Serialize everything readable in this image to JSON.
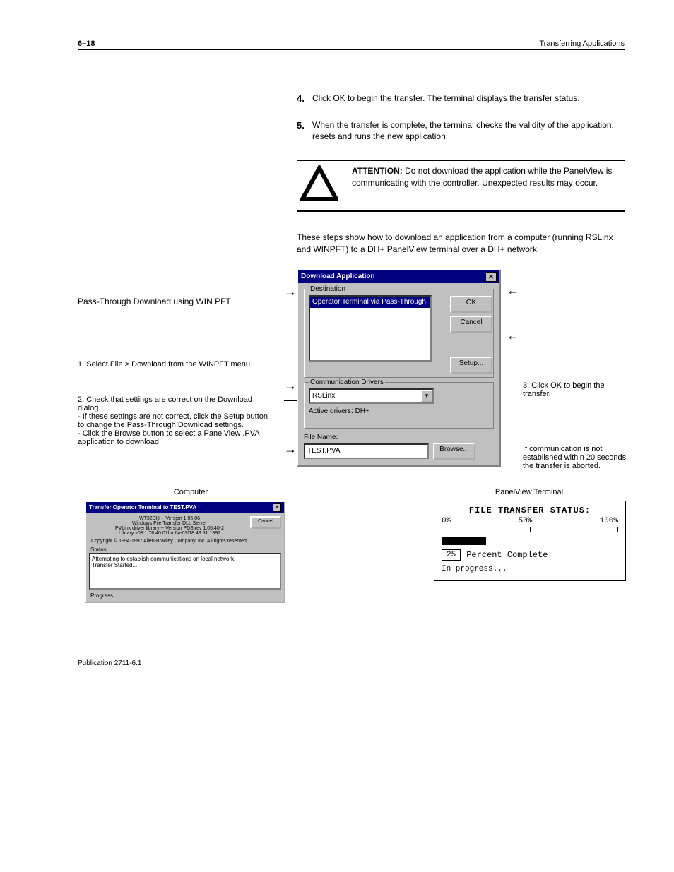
{
  "header": {
    "page_number": "6–18",
    "chapter": "Transferring Applications"
  },
  "steps": [
    {
      "num": "4.",
      "text": "Click OK to begin the transfer. The terminal displays the transfer status."
    },
    {
      "num": "5.",
      "text": "When the transfer is complete, the terminal checks the validity of the application, resets and runs the new application."
    }
  ],
  "attention": {
    "title": "ATTENTION:",
    "text": "Do not download the application while the PanelView is communicating with the controller. Unexpected results may occur."
  },
  "left_heading": "Pass-Through Download using WIN PFT",
  "intro": "These steps show how to download an application from a computer (running RSLinx and WINPFT) to a DH+ PanelView terminal over a DH+ network.",
  "dialog": {
    "title": "Download Application",
    "destination_label": "Destination",
    "destination_item": "Operator Terminal via Pass-Through",
    "ok": "OK",
    "cancel": "Cancel",
    "setup": "Setup...",
    "comm_label": "Communication Drivers",
    "comm_value": "RSLinx",
    "active_label": "Active drivers: DH+",
    "file_label": "File Name:",
    "file_value": "TEST.PVA",
    "browse": "Browse..."
  },
  "callouts": {
    "c1": "1. Select File > Download from the WINPFT menu.",
    "c2": "2. Check that settings are correct on the Download dialog.\n - If these settings are not correct, click the Setup button to change the Pass-Through Download settings.\n - Click the Browse button to select a PanelView .PVA application to download.",
    "c3": "3. Click OK to begin the transfer.",
    "c4": "If communication is not established within 20 seconds, the transfer is aborted."
  },
  "bottom": {
    "left_label": "Computer",
    "right_label": "PanelView Terminal",
    "transfer_title": "Transfer Operator Terminal to TEST.PVA",
    "small_ver": "WT32DH  --  Version 1.05.06",
    "small_l1": "Windows File Transfer DLL Server",
    "small_l2": "PVLink driver library -- Version PDS:rev 1.05.40-2",
    "small_l3": "Library    v03.1.76.40.01hu.64-03/18.49.51.1997",
    "small_copy": "Copyright © 1994-1997 Allen-Bradley Company, Inc.  All rights reserved.",
    "small_status": "Status:",
    "small_msg1": "Attempting to establish communications on local network.",
    "small_msg2": "Transfer Started...",
    "progress_label": "Progress",
    "small_cancel": "Cancel",
    "status_title": "FILE TRANSFER STATUS:",
    "p0": "0%",
    "p50": "50%",
    "p100": "100%",
    "pc_value": "25",
    "pc_label": "Percent Complete",
    "inprog": "In progress..."
  },
  "footer": "Publication 2711-6.1"
}
